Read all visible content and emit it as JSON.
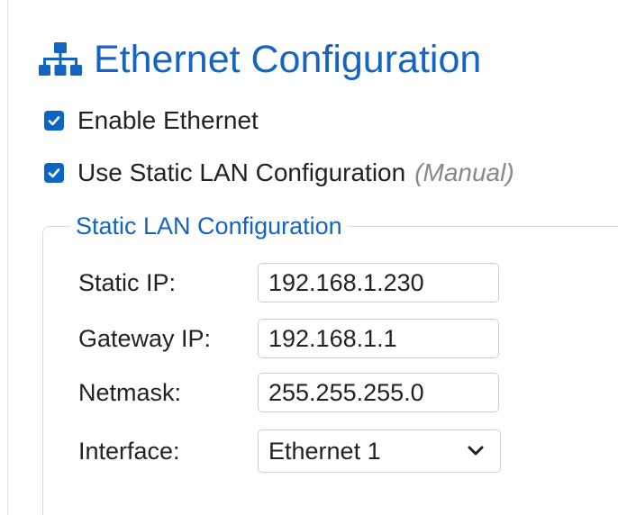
{
  "section": {
    "title": "Ethernet Configuration",
    "icon": "network-icon",
    "accent_color": "#1565c0"
  },
  "options": {
    "enable_ethernet": {
      "label": "Enable Ethernet",
      "checked": true
    },
    "use_static": {
      "label": "Use Static LAN Configuration",
      "hint": "(Manual)",
      "checked": true
    }
  },
  "static_lan": {
    "legend": "Static LAN Configuration",
    "static_ip": {
      "label": "Static IP:",
      "value": "192.168.1.230"
    },
    "gateway_ip": {
      "label": "Gateway IP:",
      "value": "192.168.1.1"
    },
    "netmask": {
      "label": "Netmask:",
      "value": "255.255.255.0"
    },
    "interface": {
      "label": "Interface:",
      "selected": "Ethernet 1"
    }
  }
}
